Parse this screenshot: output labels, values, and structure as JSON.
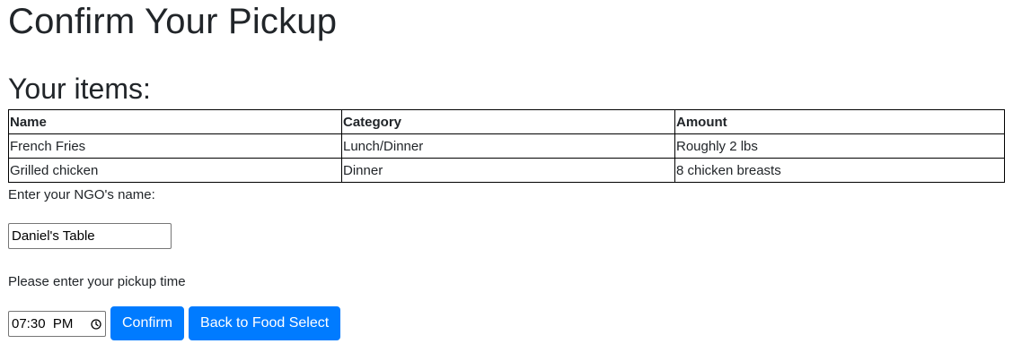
{
  "page_title": "Confirm Your Pickup",
  "items_heading": "Your items:",
  "table": {
    "headers": [
      "Name",
      "Category",
      "Amount"
    ],
    "rows": [
      [
        "French Fries",
        "Lunch/Dinner",
        "Roughly 2 lbs"
      ],
      [
        "Grilled chicken",
        "Dinner",
        "8 chicken breasts"
      ]
    ]
  },
  "ngo": {
    "label": "Enter your NGO's name:",
    "value": "Daniel's Table"
  },
  "pickup": {
    "label": "Please enter your pickup time",
    "time_value": "07:30  PM",
    "time_icon": "clock-icon"
  },
  "buttons": {
    "confirm": "Confirm",
    "back": "Back to Food Select"
  },
  "colors": {
    "primary": "#007bff",
    "text": "#212529"
  }
}
